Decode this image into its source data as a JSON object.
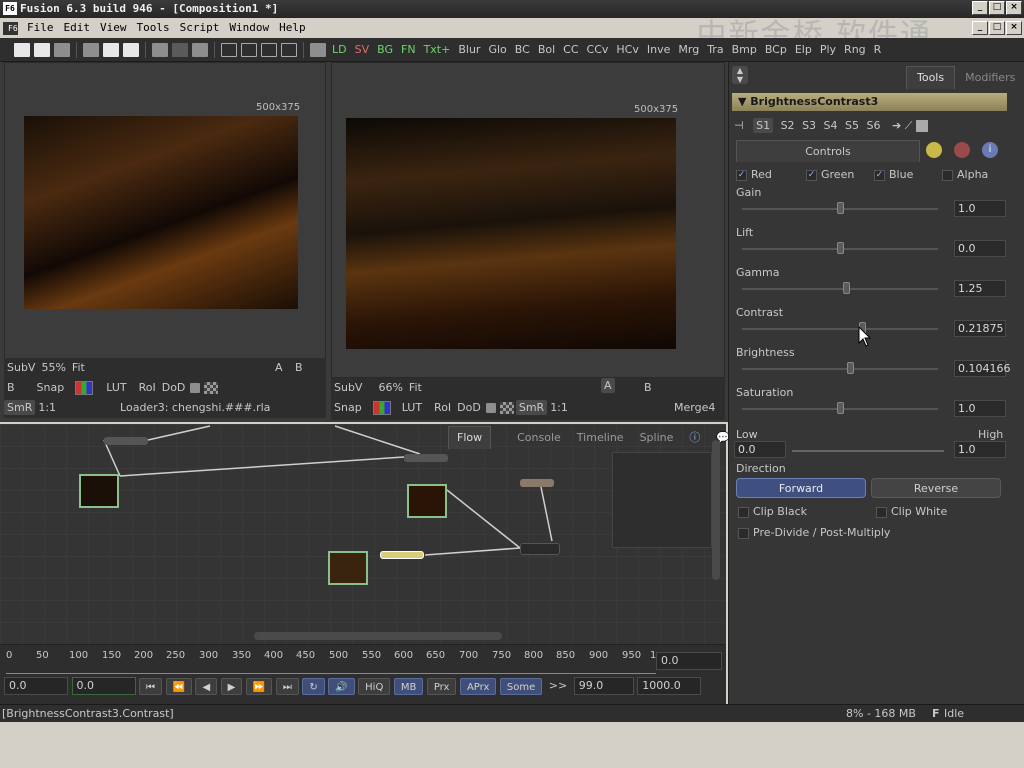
{
  "window": {
    "title": "Fusion 6.3 build 946 - [Composition1 *]",
    "app_icon": "F6",
    "watermark": "中新金桥 软件通",
    "min": "_",
    "max": "□",
    "close": "×"
  },
  "menu": {
    "items": [
      "File",
      "Edit",
      "View",
      "Tools",
      "Script",
      "Window",
      "Help"
    ]
  },
  "toolbar": {
    "tools": [
      "LD",
      "SV",
      "BG",
      "FN",
      "Txt+",
      "Blur",
      "Glo",
      "BC",
      "Bol",
      "CC",
      "CCv",
      "HCv",
      "Inve",
      "Mrg",
      "Tra",
      "Bmp",
      "BCp",
      "Elp",
      "Ply",
      "Rng",
      "R"
    ]
  },
  "viewer_left": {
    "resolution": "500x375",
    "subv": "SubV",
    "zoom": "55%",
    "fit": "Fit",
    "snap": "Snap",
    "lut": "LUT",
    "roi": "RoI",
    "dod": "DoD",
    "smr": "SmR",
    "ratio": "1:1",
    "a": "A",
    "b": "B",
    "node_name": "Loader3: chengshi.###.rla"
  },
  "viewer_right": {
    "resolution": "500x375",
    "subv": "SubV",
    "zoom": "66%",
    "fit": "Fit",
    "snap": "Snap",
    "lut": "LUT",
    "roi": "RoI",
    "dod": "DoD",
    "smr": "SmR",
    "ratio": "1:1",
    "a": "A",
    "b": "B",
    "node_name": "Merge4"
  },
  "flow_tabs": [
    "Flow",
    "Console",
    "Timeline",
    "Spline"
  ],
  "timeline": {
    "ticks": [
      "0",
      "50",
      "100",
      "150",
      "200",
      "250",
      "300",
      "350",
      "400",
      "450",
      "500",
      "550",
      "600",
      "650",
      "700",
      "750",
      "800",
      "850",
      "900",
      "950",
      "1"
    ],
    "current_value": "0.0",
    "start": "0.0",
    "render_start": "0.0",
    "buttons": [
      "HiQ",
      "MB",
      "Prx",
      "APrx",
      "Some"
    ],
    "step_label": ">>",
    "render_end": "99.0",
    "end": "1000.0"
  },
  "panel": {
    "tabs": [
      "Tools",
      "Modifiers"
    ],
    "tool_name": "BrightnessContrast3",
    "scripts": [
      "S1",
      "S2",
      "S3",
      "S4",
      "S5",
      "S6"
    ],
    "controls_tab": "Controls",
    "channels": [
      {
        "label": "Red",
        "checked": true
      },
      {
        "label": "Green",
        "checked": true
      },
      {
        "label": "Blue",
        "checked": true
      },
      {
        "label": "Alpha",
        "checked": false
      }
    ],
    "sliders": [
      {
        "label": "Gain",
        "value": "1.0",
        "level": 0.5
      },
      {
        "label": "Lift",
        "value": "0.0",
        "level": 0.5
      },
      {
        "label": "Gamma",
        "value": "1.25",
        "level": 0.53
      },
      {
        "label": "Contrast",
        "value": "0.21875",
        "level": 0.61
      },
      {
        "label": "Brightness",
        "value": "0.104166",
        "level": 0.55
      },
      {
        "label": "Saturation",
        "value": "1.0",
        "level": 0.5
      }
    ],
    "low_label": "Low",
    "high_label": "High",
    "low_value": "0.0",
    "high_value": "1.0",
    "direction_label": "Direction",
    "forward": "Forward",
    "reverse": "Reverse",
    "clip_black": "Clip Black",
    "clip_white": "Clip White",
    "predivide": "Pre-Divide / Post-Multiply"
  },
  "status": {
    "left": "[BrightnessContrast3.Contrast]",
    "memory": "8% - 168 MB",
    "state_icon": "F",
    "state": "Idle"
  }
}
